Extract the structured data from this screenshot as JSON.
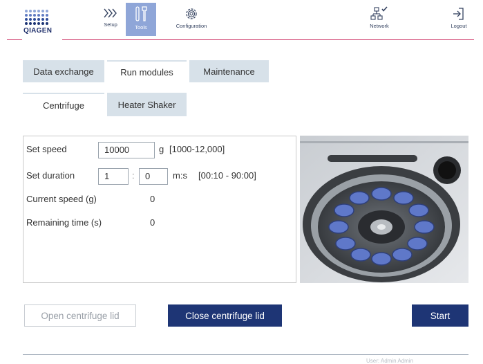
{
  "brand": {
    "logo_text": "QIAGEN",
    "accent": "#cc2b5e",
    "primary": "#1e3575"
  },
  "nav": {
    "setup": "Setup",
    "tools": "Tools",
    "configuration": "Configuration",
    "network": "Network",
    "logout": "Logout"
  },
  "tabs": {
    "data_exchange": "Data exchange",
    "run_modules": "Run modules",
    "maintenance": "Maintenance"
  },
  "subtabs": {
    "centrifuge": "Centrifuge",
    "heater_shaker": "Heater Shaker"
  },
  "form": {
    "set_speed_label": "Set speed",
    "speed_value": "10000",
    "speed_unit": "g",
    "speed_range": "[1000-12,000]",
    "set_duration_label": "Set duration",
    "duration_minutes": "1",
    "duration_sep": ":",
    "duration_seconds": "0",
    "duration_unit": "m:s",
    "duration_range": "[00:10 - 90:00]",
    "current_speed_label": "Current speed (g)",
    "current_speed_value": "0",
    "remaining_time_label": "Remaining time (s)",
    "remaining_time_value": "0"
  },
  "buttons": {
    "open_lid": "Open centrifuge lid",
    "close_lid": "Close centrifuge lid",
    "start": "Start"
  },
  "footer": {
    "user": "User: Admin Admin"
  }
}
